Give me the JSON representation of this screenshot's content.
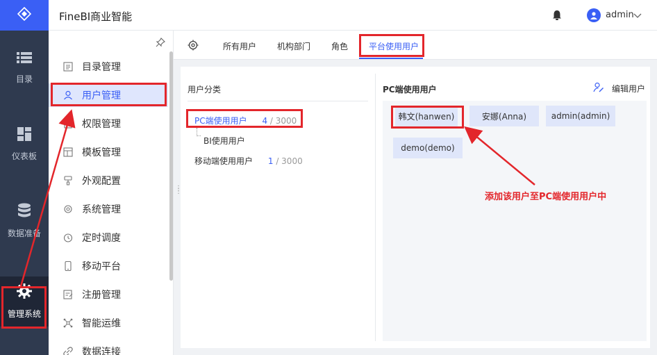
{
  "app": {
    "title": "FineBI商业智能",
    "username": "admin"
  },
  "rail": {
    "items": [
      {
        "label": "目录",
        "icon": "list-icon"
      },
      {
        "label": "仪表板",
        "icon": "dashboard-icon"
      },
      {
        "label": "数据准备",
        "icon": "database-icon"
      },
      {
        "label": "管理系统",
        "icon": "gear-icon",
        "active": true
      }
    ]
  },
  "sidebar": {
    "items": [
      {
        "label": "目录管理",
        "icon": "catalog-icon"
      },
      {
        "label": "用户管理",
        "icon": "user-icon",
        "active": true
      },
      {
        "label": "权限管理",
        "icon": "permission-icon"
      },
      {
        "label": "模板管理",
        "icon": "template-icon"
      },
      {
        "label": "外观配置",
        "icon": "brush-icon"
      },
      {
        "label": "系统管理",
        "icon": "settings-icon"
      },
      {
        "label": "定时调度",
        "icon": "clock-icon"
      },
      {
        "label": "移动平台",
        "icon": "mobile-icon"
      },
      {
        "label": "注册管理",
        "icon": "register-icon"
      },
      {
        "label": "智能运维",
        "icon": "ops-icon"
      },
      {
        "label": "数据连接",
        "icon": "link-icon"
      }
    ]
  },
  "tabs": {
    "items": [
      {
        "label": "所有用户"
      },
      {
        "label": "机构部门"
      },
      {
        "label": "角色"
      },
      {
        "label": "平台使用用户",
        "active": true
      }
    ]
  },
  "category": {
    "title": "用户分类",
    "rows": [
      {
        "label": "PC端使用用户",
        "count": "4",
        "total": "/ 3000",
        "active": true
      },
      {
        "label": "BI使用用户"
      },
      {
        "label": "移动端使用用户",
        "count": "1",
        "total": "/ 3000"
      }
    ]
  },
  "users_panel": {
    "title": "PC端使用用户",
    "edit_label": "编辑用户",
    "users": [
      "韩文(hanwen)",
      "安娜(Anna)",
      "admin(admin)",
      "demo(demo)"
    ]
  },
  "annotation": {
    "text": "添加该用户至PC端使用用户中"
  },
  "colors": {
    "accent": "#3a5ff5",
    "rail_bg": "#2f3a4f",
    "annotation_red": "#e3262b"
  }
}
